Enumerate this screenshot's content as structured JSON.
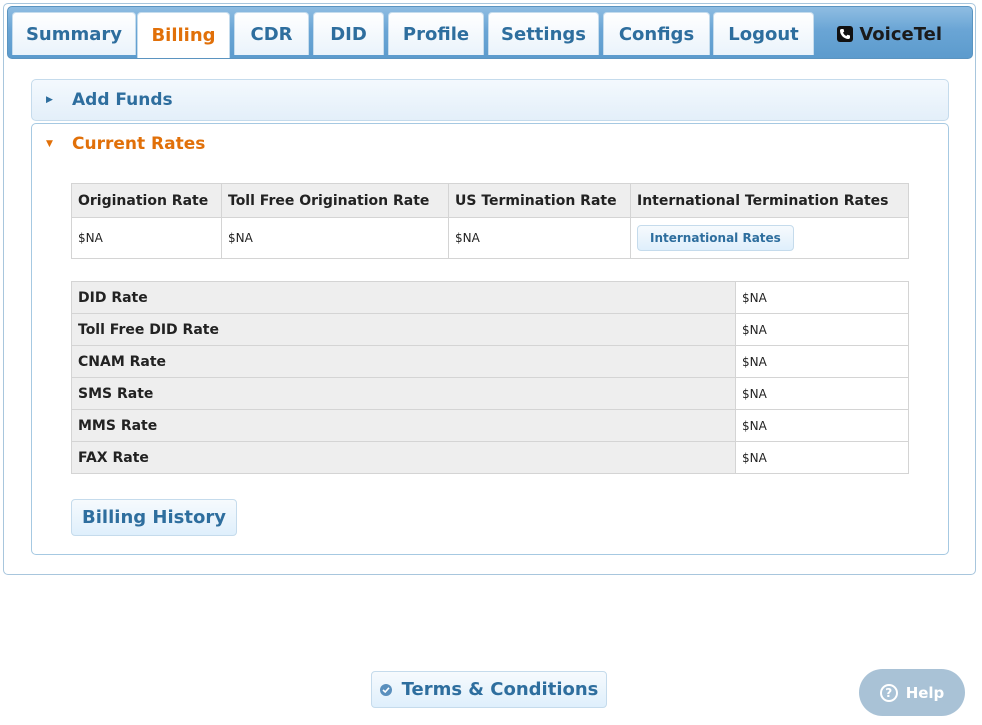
{
  "tabs": [
    {
      "label": "Summary"
    },
    {
      "label": "Billing",
      "active": true
    },
    {
      "label": "CDR"
    },
    {
      "label": "DID"
    },
    {
      "label": "Profile"
    },
    {
      "label": "Settings"
    },
    {
      "label": "Configs"
    },
    {
      "label": "Logout"
    }
  ],
  "brand": {
    "label": "VoiceTel",
    "icon": "phone-icon"
  },
  "accordion": {
    "add_funds": {
      "title": "Add Funds",
      "icon": "triangle-right-icon"
    },
    "current_rates": {
      "title": "Current Rates",
      "icon": "triangle-down-icon"
    }
  },
  "rates_table": {
    "headers": [
      "Origination Rate",
      "Toll Free Origination Rate",
      "US Termination Rate",
      "International Termination Rates"
    ],
    "values": [
      "$NA",
      "$NA",
      "$NA"
    ],
    "intl_button": "International Rates"
  },
  "misc_rates": [
    {
      "label": "DID Rate",
      "value": "$NA"
    },
    {
      "label": "Toll Free DID Rate",
      "value": "$NA"
    },
    {
      "label": "CNAM Rate",
      "value": "$NA"
    },
    {
      "label": "SMS Rate",
      "value": "$NA"
    },
    {
      "label": "MMS Rate",
      "value": "$NA"
    },
    {
      "label": "FAX Rate",
      "value": "$NA"
    }
  ],
  "billing_history_button": "Billing History",
  "terms_button": "Terms & Conditions",
  "help_button": "Help",
  "colors": {
    "accent": "#e17009",
    "link": "#2e6e9e",
    "tabbar": "#6aa5d5"
  }
}
